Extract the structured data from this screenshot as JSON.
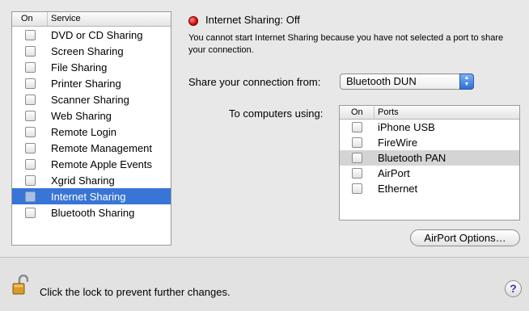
{
  "services": {
    "header_on": "On",
    "header_service": "Service",
    "items": [
      {
        "label": "DVD or CD Sharing"
      },
      {
        "label": "Screen Sharing"
      },
      {
        "label": "File Sharing"
      },
      {
        "label": "Printer Sharing"
      },
      {
        "label": "Scanner Sharing"
      },
      {
        "label": "Web Sharing"
      },
      {
        "label": "Remote Login"
      },
      {
        "label": "Remote Management"
      },
      {
        "label": "Remote Apple Events"
      },
      {
        "label": "Xgrid Sharing"
      },
      {
        "label": "Internet Sharing"
      },
      {
        "label": "Bluetooth Sharing"
      }
    ],
    "selected_index": 10
  },
  "status": {
    "text": "Internet Sharing: Off",
    "indicator_color": "#d41414",
    "notice": "You cannot start Internet Sharing because you have not selected a port to share your connection."
  },
  "share_from": {
    "label": "Share your connection from:",
    "selected": "Bluetooth DUN"
  },
  "computers_using": {
    "label": "To computers using:",
    "header_on": "On",
    "header_ports": "Ports",
    "ports": [
      {
        "label": "iPhone USB"
      },
      {
        "label": "FireWire"
      },
      {
        "label": "Bluetooth PAN"
      },
      {
        "label": "AirPort"
      },
      {
        "label": "Ethernet"
      }
    ],
    "highlighted_index": 2
  },
  "airport_options_label": "AirPort Options…",
  "lock_text": "Click the lock to prevent further changes.",
  "help_label": "?",
  "colors": {
    "selection": "#3875d7",
    "window_background": "#e8e8e8"
  }
}
